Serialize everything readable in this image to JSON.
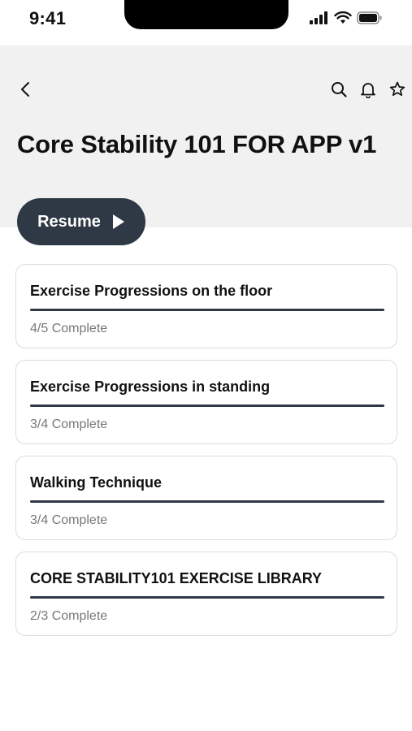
{
  "status_bar": {
    "time": "9:41",
    "icons": [
      "signal-icon",
      "wifi-icon",
      "battery-icon"
    ]
  },
  "header": {
    "back_icon": "chevron-left-icon",
    "actions": [
      "search-icon",
      "bell-icon",
      "star-icon"
    ],
    "title": "Core Stability 101 FOR APP v1"
  },
  "resume_button": {
    "label": "Resume",
    "icon": "play-icon"
  },
  "modules": [
    {
      "title": "Exercise Progressions on the floor",
      "status": "4/5 Complete"
    },
    {
      "title": "Exercise Progressions in standing",
      "status": "3/4 Complete"
    },
    {
      "title": "Walking Technique",
      "status": "3/4 Complete"
    },
    {
      "title": "CORE STABILITY101 EXERCISE LIBRARY",
      "status": "2/3 Complete"
    }
  ],
  "colors": {
    "header_bg": "#f1f1f1",
    "accent": "#2e3945",
    "card_border": "#dcdcdc",
    "muted_text": "#777777"
  }
}
